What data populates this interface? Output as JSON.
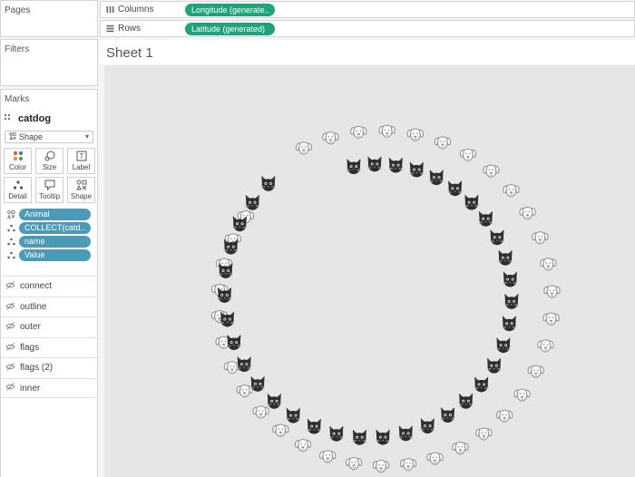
{
  "panes": {
    "pages_title": "Pages",
    "filters_title": "Filters",
    "marks_title": "Marks"
  },
  "marks": {
    "layer_name": "catdog",
    "mark_type": "Shape",
    "cards": [
      {
        "label": "Color",
        "icon": "color-icon"
      },
      {
        "label": "Size",
        "icon": "size-icon"
      },
      {
        "label": "Label",
        "icon": "label-icon"
      },
      {
        "label": "Detail",
        "icon": "detail-icon"
      },
      {
        "label": "Tooltip",
        "icon": "tooltip-icon"
      },
      {
        "label": "Shape",
        "icon": "shape-icon"
      }
    ],
    "pills": [
      {
        "label": "Animal",
        "icon": "shape-icon"
      },
      {
        "label": "COLLECT(catd..",
        "icon": "detail-icon"
      },
      {
        "label": "name",
        "icon": "detail-icon"
      },
      {
        "label": "Value",
        "icon": "detail-icon"
      }
    ],
    "hidden_layers": [
      "connect",
      "outline",
      "outer",
      "flags",
      "flags (2)",
      "inner"
    ]
  },
  "shelves": {
    "columns_label": "Columns",
    "columns_pill": "Longitude (generate..",
    "rows_label": "Rows",
    "rows_pill": "Latitude (generated)"
  },
  "sheet": {
    "title": "Sheet 1"
  },
  "viz": {
    "background": "#e6e6e6",
    "cat_color": "#2e2e2e",
    "dog_color": "#9a9a9a",
    "cat_count": 36,
    "dog_count": 36
  }
}
